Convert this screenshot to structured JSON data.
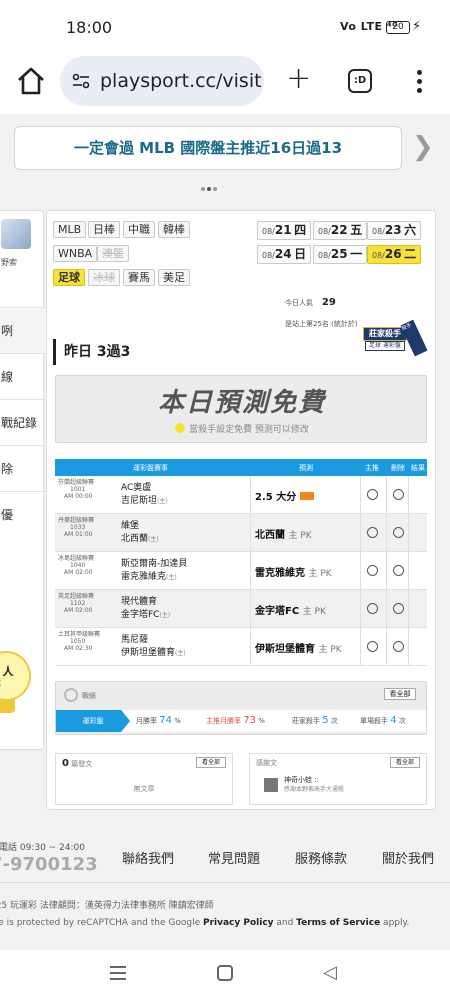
{
  "status_bar": {
    "time": "18:00",
    "signal": "Vo LTE ⁴ᴳ",
    "battery": "20"
  },
  "browser": {
    "url": "playsport.cc/visit",
    "tabs_label": ":D"
  },
  "banner": {
    "text": "一定會過 MLB 國際盤主推近16日過13"
  },
  "sidebar": {
    "avatar_caption": "野索",
    "items": [
      "咧",
      "線",
      "戰紀錄",
      "除",
      "優"
    ],
    "bulb_count": "0 人",
    "bulb_caption": "瀏覽"
  },
  "sports": {
    "row1": [
      "MLB",
      "日棒",
      "中職",
      "韓棒"
    ],
    "row2": [
      "WNBA",
      "澳籃"
    ],
    "row3": [
      "足球",
      "冰球",
      "賽馬",
      "美足"
    ],
    "active": "足球",
    "disabled": [
      "澳籃",
      "冰球"
    ]
  },
  "dates": [
    {
      "md": "08/",
      "d": "21",
      "wd": "四"
    },
    {
      "md": "08/",
      "d": "22",
      "wd": "五"
    },
    {
      "md": "08/",
      "d": "23",
      "wd": "六"
    },
    {
      "md": "08/",
      "d": "24",
      "wd": "日"
    },
    {
      "md": "08/",
      "d": "25",
      "wd": "一"
    },
    {
      "md": "08/",
      "d": "26",
      "wd": "二"
    }
  ],
  "active_date": "26",
  "stats": {
    "popularity_label": "今日人氣",
    "popularity_value": "29",
    "rank_text": "是站上第25名",
    "rank_note": "(統計於)"
  },
  "badge": {
    "line1": "莊家殺手",
    "line2": "足球 運彩盤",
    "ribbon": "殺手"
  },
  "record": "昨日 3過3",
  "promo": {
    "title": "本日預測免費",
    "subtitle": "當殺手設定免費 預測可以修改"
  },
  "table": {
    "headers": [
      "運彩盤賽事",
      "預測",
      "主推",
      "刪除",
      "結果"
    ],
    "rows": [
      {
        "league": "芬蘭超級聯賽",
        "no": "1001",
        "time": "AM 00:00",
        "home": "AC奧盧",
        "away": "吉尼斯坦",
        "away_tag": "(主)",
        "pick": "2.5 大分",
        "pick_note": "",
        "hot": true
      },
      {
        "league": "丹麥超級聯賽",
        "no": "1033",
        "time": "AM 01:00",
        "home": "維堡",
        "away": "北西蘭",
        "away_tag": "(主)",
        "pick": "北西蘭",
        "pick_note": "主 PK",
        "hot": false
      },
      {
        "league": "冰島超級聯賽",
        "no": "1040",
        "time": "AM 02:00",
        "home": "斯亞爾南-加達貝",
        "away": "雷克雅維克",
        "away_tag": "(主)",
        "pick": "雷克雅維克",
        "pick_note": "主 PK",
        "hot": false
      },
      {
        "league": "英足超級聯賽",
        "no": "1102",
        "time": "AM 02:00",
        "home": "現代體育",
        "away": "金字塔FC",
        "away_tag": "(主)",
        "pick": "金字塔FC",
        "pick_note": "主 PK",
        "hot": false
      },
      {
        "league": "土耳其甲級聯賽",
        "no": "1050",
        "time": "AM 02:30",
        "home": "馬尼薩",
        "away": "伊斯坦堡體育",
        "away_tag": "(主)",
        "pick": "伊斯坦堡體育",
        "pick_note": "主 PK",
        "hot": false
      }
    ]
  },
  "performance": {
    "header": "戰績",
    "see_all": "看全部",
    "tabs": [
      {
        "label": "運彩盤",
        "value": ""
      },
      {
        "label": "月勝率",
        "value": "74",
        "unit": "%"
      },
      {
        "label": "主推月勝率",
        "value": "73",
        "unit": "%"
      },
      {
        "label": "莊家殺手",
        "value": "5",
        "unit": "次"
      },
      {
        "label": "單場殺手",
        "value": "4",
        "unit": "次"
      }
    ]
  },
  "boxes": {
    "left_count": "0",
    "left_label": "篇發文",
    "left_see": "看全部",
    "left_empty": "無文章",
    "right_label": "感謝文",
    "right_see": "看全部",
    "right_author": "神奇小蛙 ::",
    "right_text": "感謝本野索高手大通殺"
  },
  "footer": {
    "hours": "服電話 09:30 ~ 24:00",
    "phone": "7-9700123",
    "links": [
      "聯絡我們",
      "常見問題",
      "服務條款",
      "關於我們"
    ],
    "copyright": "025 玩運彩 法律顧問：漢英得力法律事務所 陳鎮宏律師",
    "recaptcha_pre": "s site is protected by reCAPTCHA and the Google ",
    "privacy": "Privacy Policy",
    "recaptcha_and": " and ",
    "terms": "Terms of Service",
    "recaptcha_post": " apply."
  }
}
